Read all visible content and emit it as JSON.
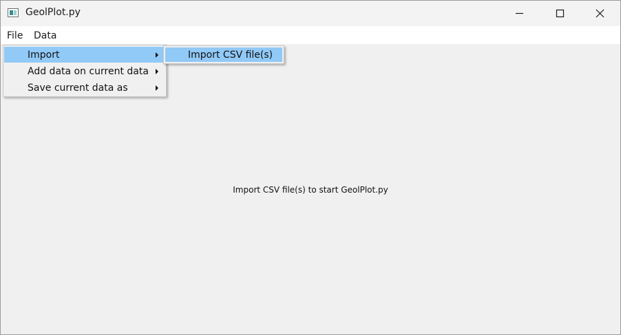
{
  "window": {
    "title": "GeolPlot.py",
    "controls": {
      "minimize": "minimize-icon",
      "maximize": "maximize-icon",
      "close": "close-icon"
    }
  },
  "menubar": {
    "items": [
      {
        "label": "File"
      },
      {
        "label": "Data"
      }
    ]
  },
  "file_menu": {
    "items": [
      {
        "label": "Import",
        "has_submenu": true,
        "highlighted": true
      },
      {
        "label": "Add data on current data",
        "has_submenu": true,
        "highlighted": false
      },
      {
        "label": "Save current data as",
        "has_submenu": true,
        "highlighted": false
      }
    ]
  },
  "import_submenu": {
    "items": [
      {
        "label": "Import CSV file(s)",
        "highlighted": true
      }
    ]
  },
  "main": {
    "message": "Import CSV file(s) to start GeolPlot.py"
  },
  "colors": {
    "highlight": "#91c9f7",
    "window_bg": "#f0f0f0",
    "menubar_bg": "#ffffff"
  }
}
